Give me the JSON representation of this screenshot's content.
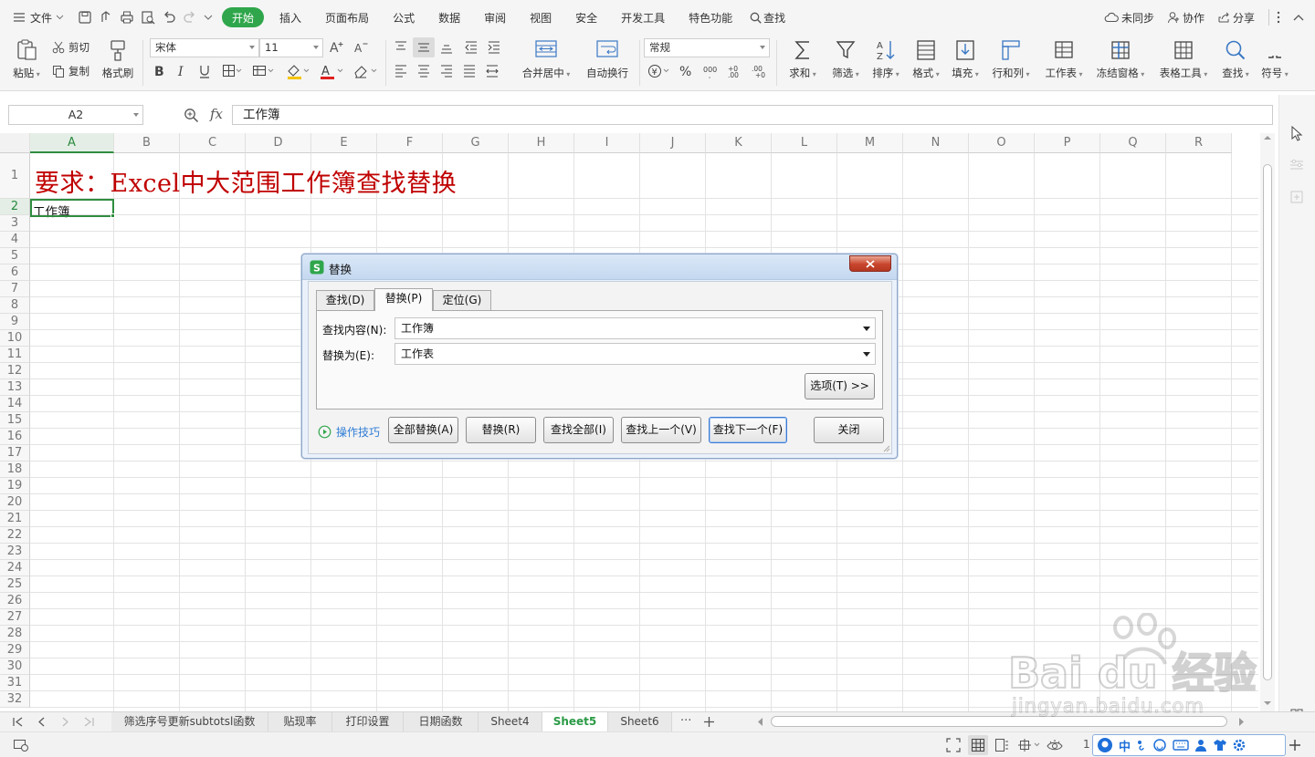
{
  "menubar": {
    "file": "文件",
    "tabs": [
      "开始",
      "插入",
      "页面布局",
      "公式",
      "数据",
      "审阅",
      "视图",
      "安全",
      "开发工具",
      "特色功能"
    ],
    "search": "查找",
    "sync": "未同步",
    "collab": "协作",
    "share": "分享"
  },
  "ribbon": {
    "paste": "粘贴",
    "cut": "剪切",
    "copy": "复制",
    "format_painter": "格式刷",
    "font_name": "宋体",
    "font_size": "11",
    "merge_center": "合并居中",
    "wrap_text": "自动换行",
    "number_format": "常规",
    "sum": "求和",
    "filter": "筛选",
    "sort": "排序",
    "format": "格式",
    "fill": "填充",
    "row_col": "行和列",
    "worksheet": "工作表",
    "freeze": "冻结窗格",
    "table_tools": "表格工具",
    "find": "查找",
    "symbol": "符号"
  },
  "formula_bar": {
    "cell_ref": "A2",
    "fx": "fx",
    "value": "工作簿"
  },
  "sheet": {
    "columns": [
      "A",
      "B",
      "C",
      "D",
      "E",
      "F",
      "G",
      "H",
      "I",
      "J",
      "K",
      "L",
      "M",
      "N",
      "O",
      "P",
      "Q",
      "R"
    ],
    "rows": [
      "1",
      "2",
      "3",
      "4",
      "5",
      "6",
      "7",
      "8",
      "9",
      "10",
      "11",
      "12",
      "13",
      "14",
      "15",
      "16",
      "17",
      "18",
      "19",
      "20",
      "21",
      "22",
      "23",
      "24",
      "25",
      "26",
      "27",
      "28",
      "29",
      "30",
      "31",
      "32"
    ],
    "a1": "要求：Excel中大范围工作簿查找替换",
    "a2": "工作簿"
  },
  "sheet_tabs": [
    "筛选序号更新subtotsl函数",
    "贴现率",
    "打印设置",
    "日期函数",
    "Sheet4",
    "Sheet5",
    "Sheet6"
  ],
  "active_sheet": "Sheet5",
  "dialog": {
    "title": "替换",
    "tabs": [
      "查找(D)",
      "替换(P)",
      "定位(G)"
    ],
    "find_label": "查找内容(N):",
    "find_value": "工作簿",
    "replace_label": "替换为(E):",
    "replace_value": "工作表",
    "options_btn": "选项(T) >>",
    "tips": "操作技巧",
    "replace_all": "全部替换(A)",
    "replace": "替换(R)",
    "find_all": "查找全部(I)",
    "find_prev": "查找上一个(V)",
    "find_next": "查找下一个(F)",
    "close": "关闭"
  },
  "status": {
    "zoom_prefix": "1",
    "ime": "中"
  },
  "watermark": {
    "brand": "Bai du 经验",
    "url": "jingyan.baidu.com"
  },
  "colors": {
    "accent": "#2fa64b",
    "title_red": "#c00000",
    "dialog_border": "#8fa6c5"
  }
}
